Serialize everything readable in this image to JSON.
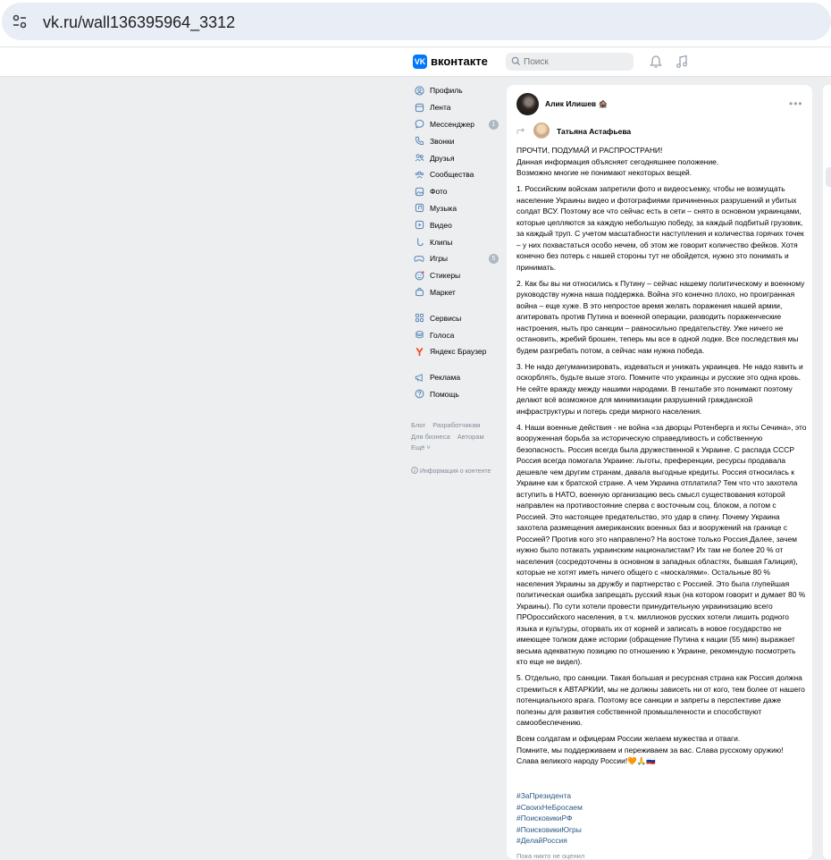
{
  "browser": {
    "url": "vk.ru/wall136395964_3312",
    "site_icon": "tune-icon"
  },
  "header": {
    "logo_mark": "VK",
    "logo_text": "вконтакте",
    "search_placeholder": "Поиск",
    "icons": [
      "bell-icon",
      "music-icon"
    ],
    "accent_color": "#0077ff"
  },
  "sidebar": {
    "items": [
      {
        "label": "Профиль",
        "icon": "profile-icon"
      },
      {
        "label": "Лента",
        "icon": "news-icon"
      },
      {
        "label": "Мессенджер",
        "icon": "messenger-icon",
        "badge": "1"
      },
      {
        "label": "Звонки",
        "icon": "phone-icon"
      },
      {
        "label": "Друзья",
        "icon": "friends-icon"
      },
      {
        "label": "Сообщества",
        "icon": "communities-icon"
      },
      {
        "label": "Фото",
        "icon": "photo-icon"
      },
      {
        "label": "Музыка",
        "icon": "music-icon"
      },
      {
        "label": "Видео",
        "icon": "video-icon"
      },
      {
        "label": "Клипы",
        "icon": "clips-icon"
      },
      {
        "label": "Игры",
        "icon": "games-icon",
        "badge": "5"
      },
      {
        "label": "Стикеры",
        "icon": "stickers-icon"
      },
      {
        "label": "Маркет",
        "icon": "market-icon"
      }
    ],
    "items2": [
      {
        "label": "Сервисы",
        "icon": "services-icon"
      },
      {
        "label": "Голоса",
        "icon": "voices-icon"
      },
      {
        "label": "Яндекс Браузер",
        "icon": "yandex-icon"
      }
    ],
    "items3": [
      {
        "label": "Реклама",
        "icon": "ads-icon"
      },
      {
        "label": "Помощь",
        "icon": "help-icon"
      }
    ],
    "footer": {
      "blog": "Блог",
      "developers": "Разработчикам",
      "business": "Для бизнеса",
      "authors": "Авторам",
      "more": "Ещё ˅"
    },
    "info": "Информация о контенте"
  },
  "post": {
    "author": "Алик Илишев 🏚️",
    "repost_author": "Татьяна Астафьева",
    "paragraphs": [
      "ПРОЧТИ, ПОДУМАЙ И РАСПРОСТРАНИ!\nДанная информация объясняет сегодняшнее положение.\nВозможно многие не понимают некоторых вещей.",
      "1. Российским войскам запретили фото и видеосъемку, чтобы не возмущать население Украины видео и фотографиями причиненных разрушений и убитых солдат ВСУ. Поэтому все что сейчас есть в сети – снято в основном украинцами, которые цепляются за каждую небольшую победу, за каждый подбитый грузовик, за каждый труп. С учетом масштабности наступления и количества горячих точек – у них похвастаться особо нечем, об этом же говорит количество фейков. Хотя конечно без потерь с нашей стороны тут не обойдется, нужно это понимать и принимать.",
      "2. Как бы вы ни относились к Путину – сейчас нашему политическому и военному руководству нужна наша поддержка. Война это конечно плохо, но проигранная война – еще хуже. В это непростое время желать поражения нашей армии, агитировать против Путина и военной операции, разводить пораженческие настроения, ныть про санкции – равносильно предательству. Уже ничего не остановить, жребий брошен, теперь мы все в одной лодке. Все последствия мы будем разгребать потом, а сейчас нам нужна победа.",
      "3. Не надо дегуманизировать, издеваться и унижать украинцев. Не надо язвить и оскорблять, будьте выше этого. Помните что украинцы и русские это одна кровь. Не сейте вражду между нашими народами. В генштабе это понимают поэтому делают всё возможное для минимизации разрушений гражданской инфраструктуры и потерь среди мирного населения.",
      "4. Наши военные действия - не война «за дворцы Ротенберга и яхты Сечина», это вооруженная борьба за историческую справедливость и собственную безопасность. Россия всегда была дружественной к Украине. С распада СССР Россия всегда помогала Украине: льготы, преференции, ресурсы продавала дешевле чем другим странам, давала выгодные кредиты. Россия относилась к Украине как к братской стране. А чем Украина отплатила? Тем что что захотела вступить в НАТО, военную организацию весь смысл существования которой направлен на противостояние сперва с восточным соц. блоком, а потом с Россией. Это настоящее предательство, это удар в спину. Почему Украина захотела размещения американских военных баз и вооружений на границе с Россией? Против кого это направлено? На востоке только Россия.Далее, зачем нужно было потакать украинским националистам? Их там не более 20 % от населения (сосредоточены в основном в западных областях, бывшая Галиция), которые не хотят иметь ничего общего с «москалями». Остальные 80 % населения Украины за дружбу и партнерство с Россией. Это была глупейшая политическая ошибка запрещать русский язык (на котором говорит и думает 80 % Украины). По сути хотели провести принудительную украинизацию всего ПРОроссийского населения, в т.ч. миллионов русских хотели лишить родного языка и культуры, оторвать их от корней и записать в новое государство не имеющее толком даже истории (обращение Путина к нации (55 мин) выражает весьма адекватную позицию по отношению к Украине, рекомендую посмотреть кто еще не видел).",
      "5. Отдельно, про санкции. Такая большая и ресурсная страна как Россия должна стремиться к АВТАРКИИ, мы не должны зависеть ни от кого, тем более от нашего потенциального врага. Поэтому все санкции и запреты в перспективе даже полезны для развития собственной промышленности и способствуют самообеспечению.",
      "Всем солдатам и офицерам России желаем мужества и отваги.\nПомните, мы поддерживаем и переживаем за вас. Слава русскому оружию!\nСлава великого народу России!🧡🙏🇷🇺"
    ],
    "hashtags": [
      "#ЗаПрезидента",
      "#СвоихНеБросаем",
      "#ПоисковикиРФ",
      "#ПоисковикиЮгры",
      "#ДелайРоссия"
    ],
    "likes_text": "Пока никто не оценил"
  }
}
